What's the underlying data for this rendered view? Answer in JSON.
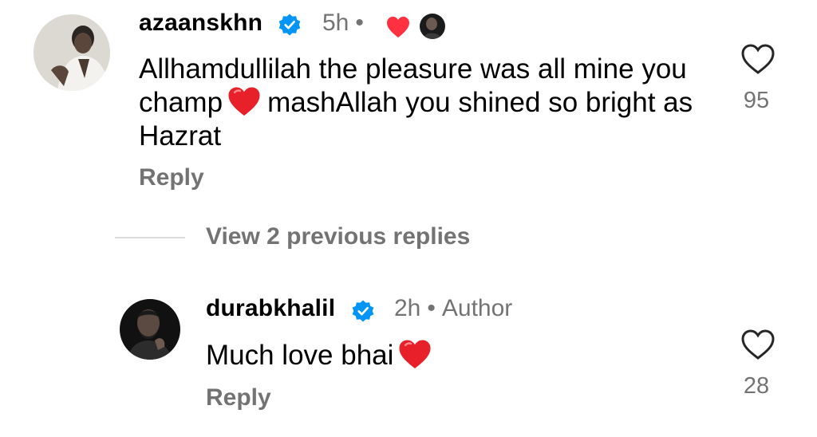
{
  "comment": {
    "username": "azaanskhn",
    "verified": true,
    "time": "5h",
    "separator": "•",
    "text_part1": "Allhamdullilah the pleasure was all mine you champ",
    "text_part2": "mashAllah you shined so bright as Hazrat",
    "inline_emoji": "red-heart",
    "reply_label": "Reply",
    "like_count": "95",
    "liked_by_author_icon": "red-heart",
    "author_avatar_icon": "author-avatar"
  },
  "view_replies": {
    "label": "View 2 previous replies"
  },
  "reply": {
    "username": "durabkhalil",
    "verified": true,
    "time": "2h",
    "separator": "•",
    "author_tag": "Author",
    "text": "Much love bhai",
    "inline_emoji": "red-heart",
    "reply_label": "Reply",
    "like_count": "28"
  },
  "colors": {
    "text": "#000000",
    "secondary": "#737373",
    "verified_blue": "#0095f6",
    "heart_red": "#ff3040",
    "divider": "#dbdbdb"
  }
}
